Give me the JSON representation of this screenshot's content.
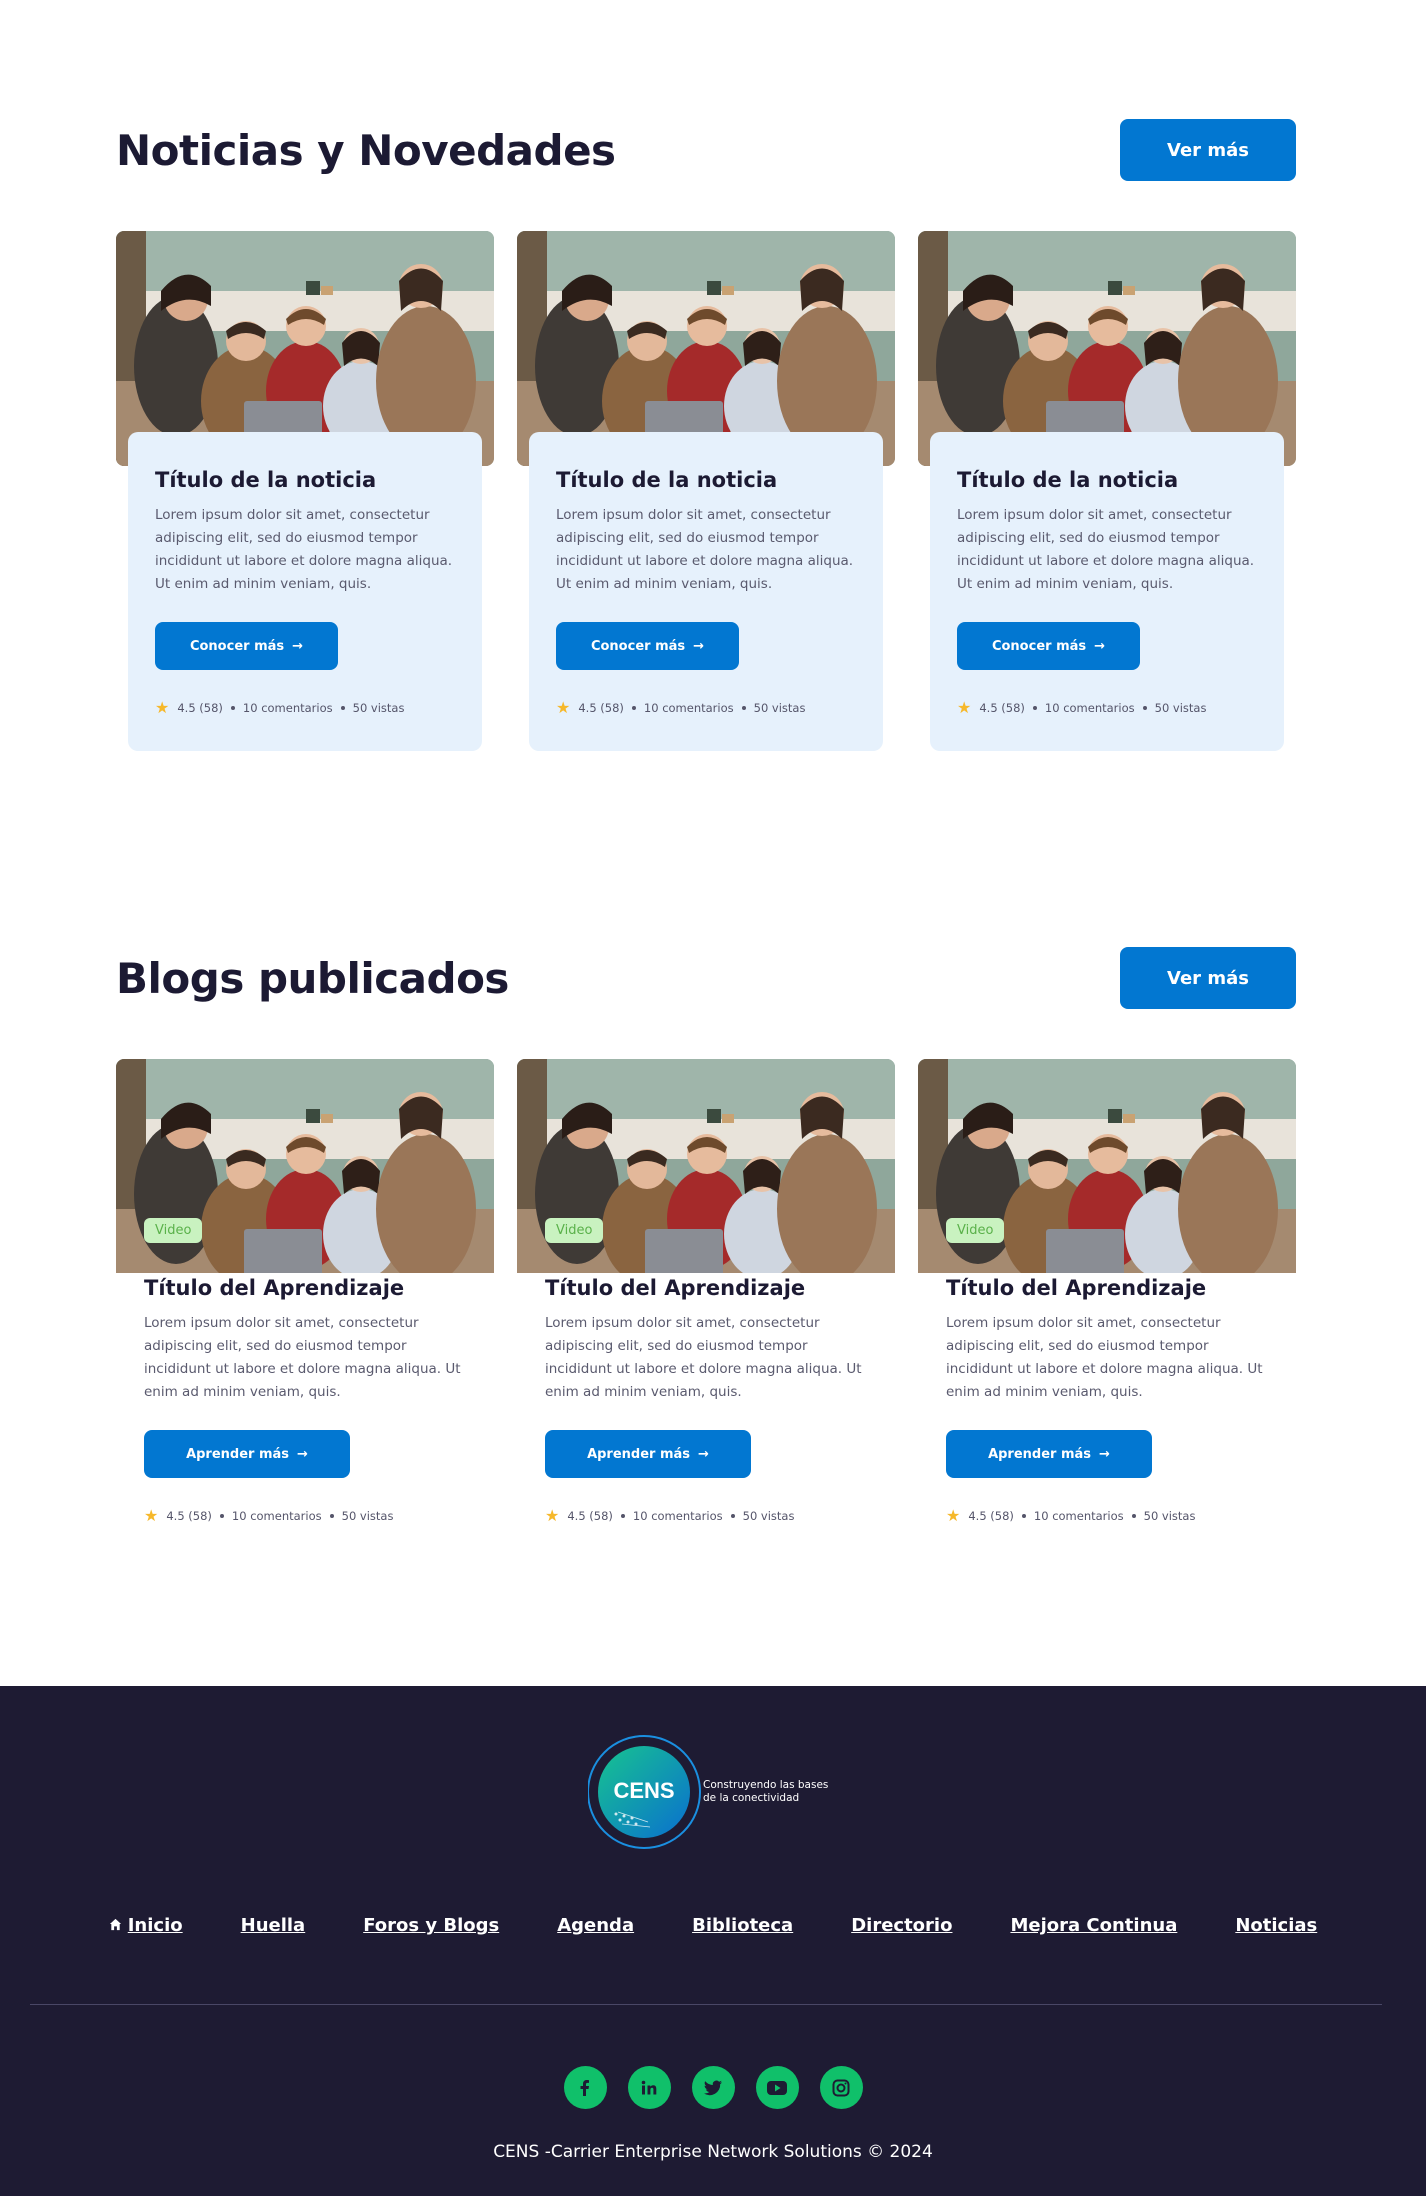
{
  "news": {
    "title": "Noticias y Novedades",
    "more_label": "Ver más",
    "cards": [
      {
        "title": "Título de la noticia",
        "desc": "Lorem ipsum dolor sit amet, consectetur adipiscing elit, sed do eiusmod tempor incididunt ut labore et dolore magna aliqua. Ut enim ad minim veniam, quis.",
        "cta": "Conocer más",
        "rating": "4.5 (58)",
        "comments": "10 comentarios",
        "views": "50 vistas"
      },
      {
        "title": "Título de la noticia",
        "desc": "Lorem ipsum dolor sit amet, consectetur adipiscing elit, sed do eiusmod tempor incididunt ut labore et dolore magna aliqua. Ut enim ad minim veniam, quis.",
        "cta": "Conocer más",
        "rating": "4.5 (58)",
        "comments": "10 comentarios",
        "views": "50 vistas"
      },
      {
        "title": "Título de la noticia",
        "desc": "Lorem ipsum dolor sit amet, consectetur adipiscing elit, sed do eiusmod tempor incididunt ut labore et dolore magna aliqua. Ut enim ad minim veniam, quis.",
        "cta": "Conocer más",
        "rating": "4.5 (58)",
        "comments": "10 comentarios",
        "views": "50 vistas"
      }
    ]
  },
  "blogs": {
    "title": "Blogs publicados",
    "more_label": "Ver más",
    "cards": [
      {
        "badge": "Video",
        "title": "Título del Aprendizaje",
        "desc": "Lorem ipsum dolor sit amet, consectetur adipiscing elit, sed do eiusmod tempor incididunt ut labore et dolore magna aliqua. Ut enim ad minim veniam, quis.",
        "cta": "Aprender más",
        "rating": "4.5 (58)",
        "comments": "10 comentarios",
        "views": "50 vistas"
      },
      {
        "badge": "Video",
        "title": "Título del Aprendizaje",
        "desc": "Lorem ipsum dolor sit amet, consectetur adipiscing elit, sed do eiusmod tempor incididunt ut labore et dolore magna aliqua. Ut enim ad minim veniam, quis.",
        "cta": "Aprender más",
        "rating": "4.5 (58)",
        "comments": "10 comentarios",
        "views": "50 vistas"
      },
      {
        "badge": "Video",
        "title": "Título del Aprendizaje",
        "desc": "Lorem ipsum dolor sit amet, consectetur adipiscing elit, sed do eiusmod tempor incididunt ut labore et dolore magna aliqua. Ut enim ad minim veniam, quis.",
        "cta": "Aprender más",
        "rating": "4.5 (58)",
        "comments": "10 comentarios",
        "views": "50 vistas"
      }
    ]
  },
  "footer": {
    "logo_text": "CENS",
    "tagline_1": "Construyendo las bases",
    "tagline_2": "de la conectividad",
    "nav": [
      "Inicio",
      "Huella",
      "Foros y Blogs",
      "Agenda",
      "Biblioteca",
      "Directorio",
      "Mejora Continua",
      "Noticias"
    ],
    "socials": [
      "facebook-icon",
      "linkedin-icon",
      "twitter-icon",
      "youtube-icon",
      "instagram-icon"
    ],
    "copyright": "CENS -Carrier Enterprise Network Solutions © 2024"
  },
  "colors": {
    "primary": "#0277d1",
    "dark": "#1e1b33",
    "card_bg": "#e6f1fc",
    "social": "#10c06a",
    "badge_bg": "#c9f2c0",
    "star": "#f6b82b"
  }
}
